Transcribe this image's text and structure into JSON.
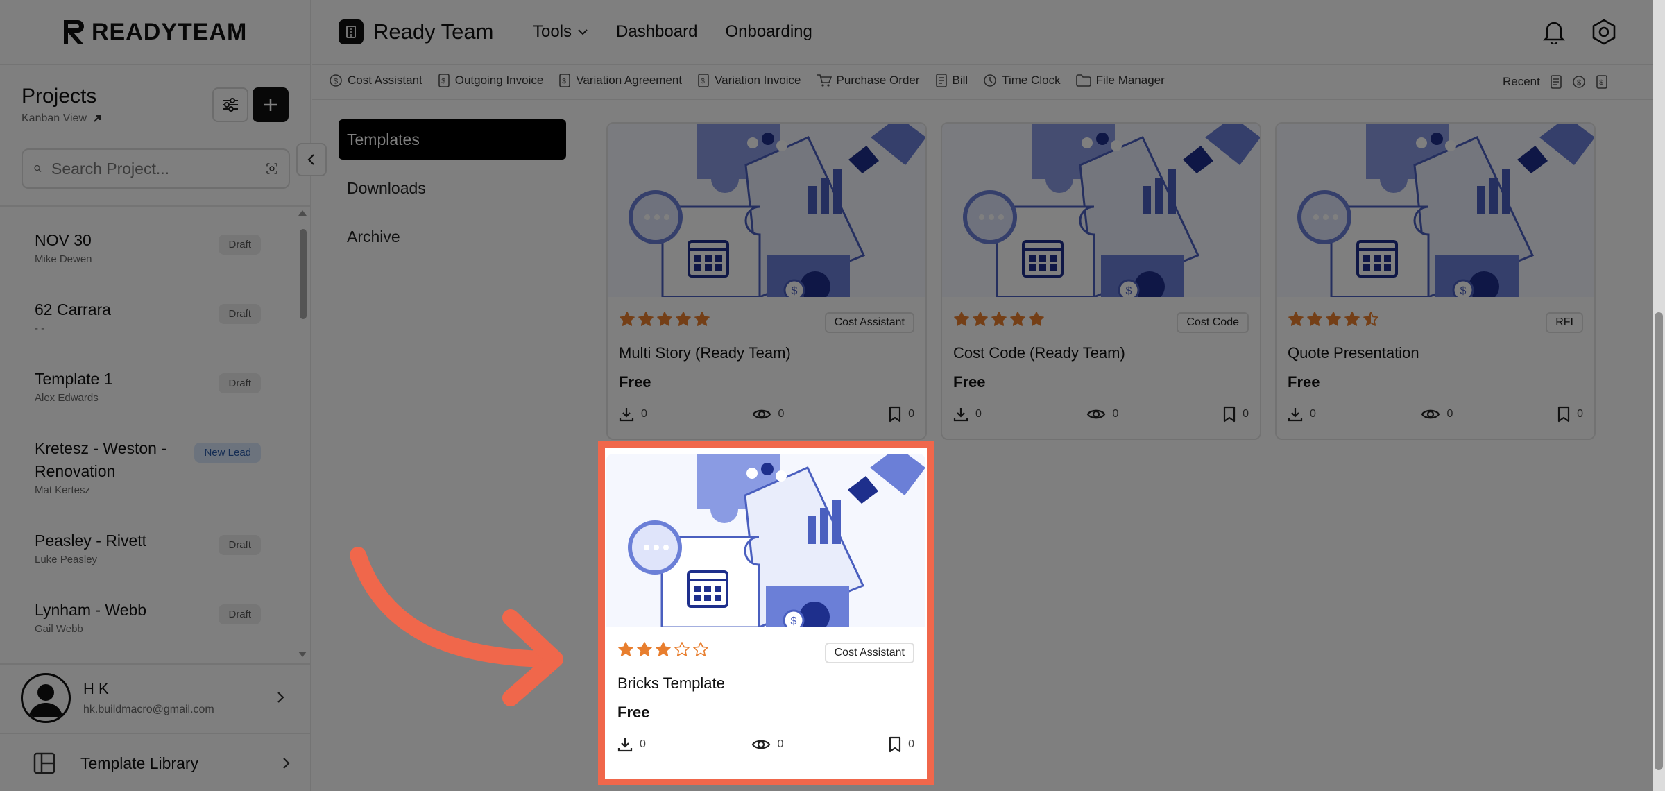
{
  "sidebar": {
    "logo": "READYTEAM",
    "projects_title": "Projects",
    "kanban_label": "Kanban View",
    "search_placeholder": "Search Project...",
    "items": [
      {
        "name": "NOV 30",
        "sub": "Mike Dewen",
        "badge": "Draft"
      },
      {
        "name": "62 Carrara",
        "sub": "- -",
        "badge": "Draft"
      },
      {
        "name": "Template 1",
        "sub": "Alex Edwards",
        "badge": "Draft"
      },
      {
        "name": "Kretesz - Weston - Renovation",
        "sub": "Mat Kertesz",
        "badge": "New Lead"
      },
      {
        "name": "Peasley - Rivett",
        "sub": "Luke Peasley",
        "badge": "Draft"
      },
      {
        "name": "Lynham - Webb",
        "sub": "Gail Webb",
        "badge": "Draft"
      }
    ],
    "user": {
      "name": "H K",
      "email": "hk.buildmacro@gmail.com"
    },
    "template_library": "Template Library"
  },
  "header": {
    "brand": "Ready Team",
    "nav": [
      "Tools",
      "Dashboard",
      "Onboarding"
    ]
  },
  "toolbar": {
    "items": [
      "Cost Assistant",
      "Outgoing Invoice",
      "Variation Agreement",
      "Variation Invoice",
      "Purchase Order",
      "Bill",
      "Time Clock",
      "File Manager"
    ],
    "recent": "Recent"
  },
  "tabs": [
    "Templates",
    "Downloads",
    "Archive"
  ],
  "cards": [
    {
      "title": "Multi Story (Ready Team)",
      "tag": "Cost Assistant",
      "price": "Free",
      "rating": 5,
      "downloads": "0",
      "views": "0",
      "saves": "0"
    },
    {
      "title": "Cost Code (Ready Team)",
      "tag": "Cost Code",
      "price": "Free",
      "rating": 5,
      "downloads": "0",
      "views": "0",
      "saves": "0"
    },
    {
      "title": "Quote Presentation",
      "tag": "RFI",
      "price": "Free",
      "rating": 4.5,
      "downloads": "0",
      "views": "0",
      "saves": "0"
    },
    {
      "title": "Bricks Template",
      "tag": "Cost Assistant",
      "price": "Free",
      "rating": 3,
      "downloads": "0",
      "views": "0",
      "saves": "0"
    }
  ],
  "colors": {
    "accent": "#f0674b",
    "star": "#e87e2e",
    "illustration": "#6b7fd7",
    "badge_lead": "#d9e7fb"
  },
  "icons": [
    "bell-icon",
    "settings-icon",
    "search-icon",
    "scan-icon",
    "filter-icon",
    "plus-icon",
    "download-icon",
    "eye-icon",
    "bookmark-icon"
  ]
}
